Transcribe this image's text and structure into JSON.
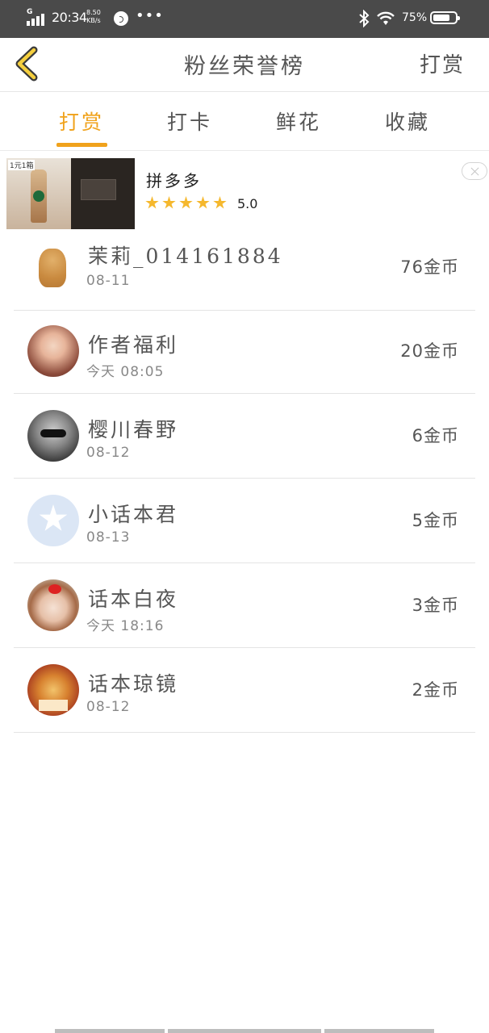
{
  "status_bar": {
    "network": "G",
    "time": "20:34",
    "speed_value": "8.50",
    "speed_unit": "KB/s",
    "more": "•••",
    "battery_percent": "75%",
    "battery_level": 0.75
  },
  "header": {
    "title": "粉丝荣誉榜",
    "action": "打赏"
  },
  "tabs": [
    {
      "label": "打赏",
      "active": true
    },
    {
      "label": "打卡",
      "active": false
    },
    {
      "label": "鲜花",
      "active": false
    },
    {
      "label": "收藏",
      "active": false
    }
  ],
  "ad": {
    "image_badge": "1元1箱",
    "name": "拼多多",
    "stars": 5,
    "rating": "5.0"
  },
  "supporters": [
    {
      "name": "茉莉_014161884",
      "date": "08-11",
      "amount": "76金币",
      "avatar": "golden-retriever-avatar"
    },
    {
      "name": "作者福利",
      "date": "今天  08:05",
      "amount": "20金币",
      "avatar": "anime-girl-avatar"
    },
    {
      "name": "樱川春野",
      "date": "08-12",
      "amount": "6金币",
      "avatar": "masked-person-avatar"
    },
    {
      "name": "小话本君",
      "date": "08-13",
      "amount": "5金币",
      "avatar": "app-logo-avatar"
    },
    {
      "name": "话本白夜",
      "date": "今天  18:16",
      "amount": "3金币",
      "avatar": "girl-with-bow-avatar"
    },
    {
      "name": "话本琼镜",
      "date": "08-12",
      "amount": "2金币",
      "avatar": "book-cover-avatar"
    }
  ],
  "colors": {
    "accent": "#f0a21b",
    "status_bar_bg": "#4a4a4a",
    "text": "#555555",
    "secondary_text": "#888888",
    "star": "#f5b82e"
  }
}
